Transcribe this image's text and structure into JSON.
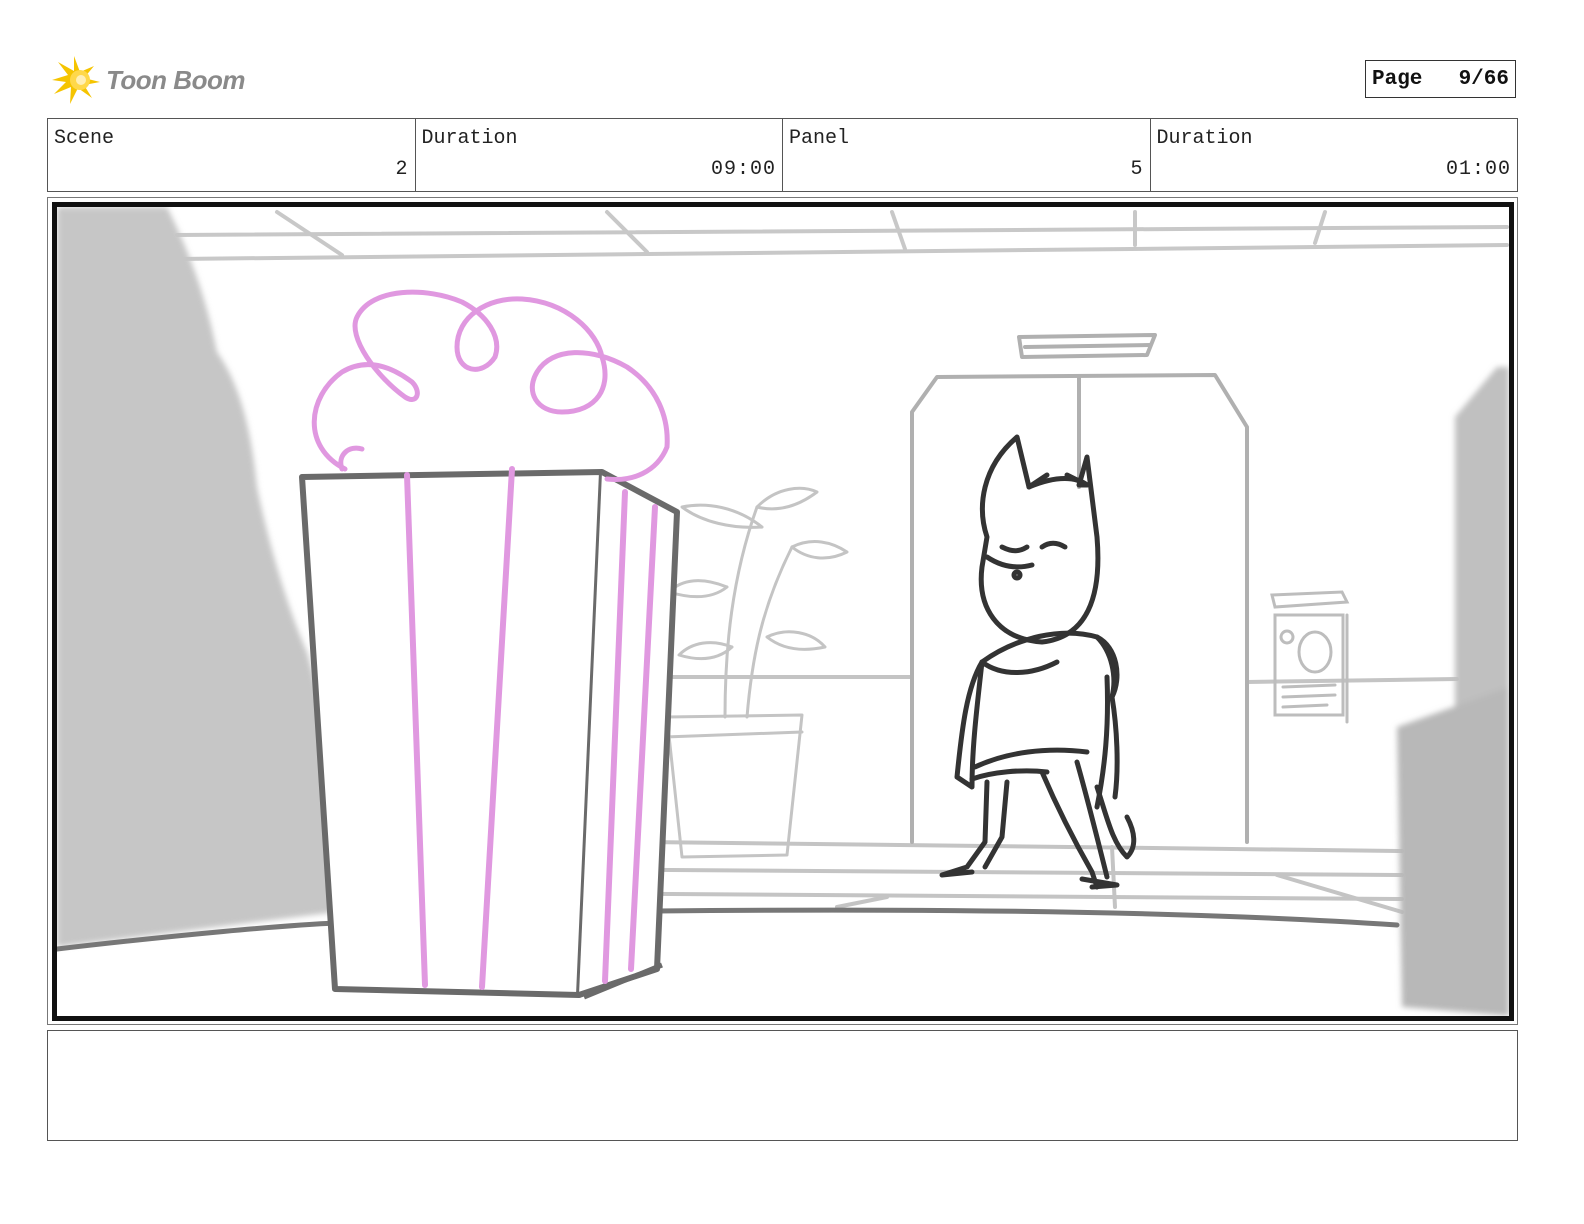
{
  "header": {
    "logo_text": "Toon Boom",
    "logo_icon": "starburst-logo-icon",
    "page_label": "Page",
    "page_number": "9/66"
  },
  "info": {
    "scene_label": "Scene",
    "scene_value": "2",
    "scene_duration_label": "Duration",
    "scene_duration_value": "09:00",
    "panel_label": "Panel",
    "panel_value": "5",
    "panel_duration_label": "Duration",
    "panel_duration_value": "01:00"
  },
  "colors": {
    "sketch_dark": "#444444",
    "sketch_light": "#b8b8b8",
    "sketch_pink": "#e098e0",
    "shadow_gray": "#c4c4c4",
    "logo_yellow": "#f5c400",
    "logo_text": "#8a8a8a"
  },
  "notes": {
    "text": ""
  }
}
